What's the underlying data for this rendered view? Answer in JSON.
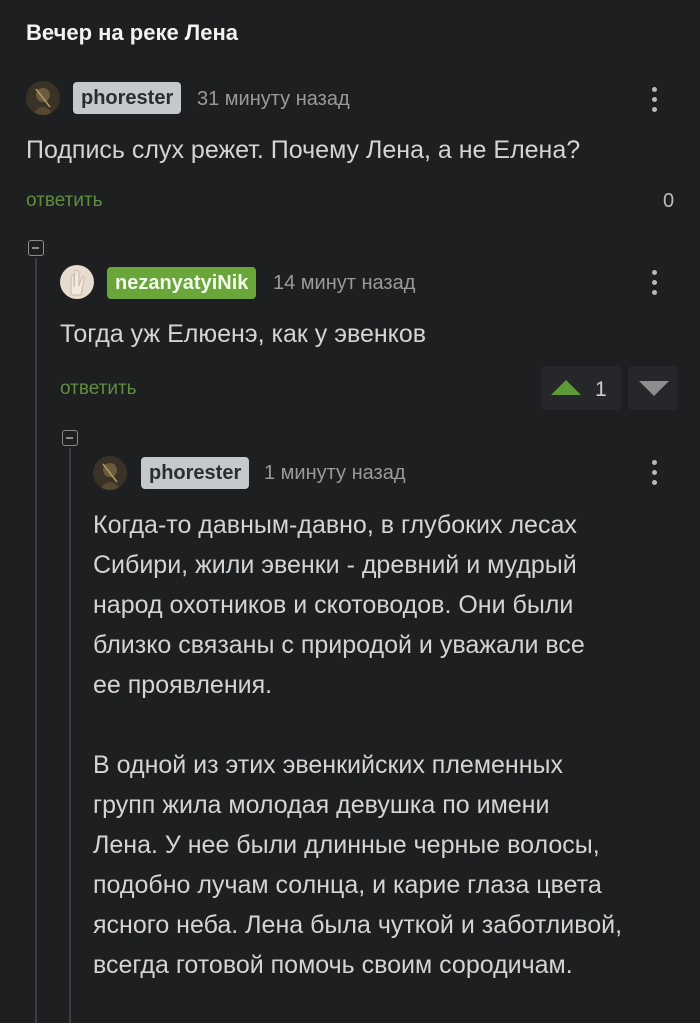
{
  "post": {
    "title": "Вечер на реке Лена"
  },
  "comments": [
    {
      "username": "phorester",
      "time": "31 минуту назад",
      "text": "Подпись слух режет. Почему Лена, а не Елена?",
      "reply_label": "ответить",
      "score": "0"
    },
    {
      "username": "nezanyatyiNik",
      "time": "14 минут назад",
      "text": "Тогда уж Елюенэ, как у эвенков",
      "reply_label": "ответить",
      "score": "1"
    },
    {
      "username": "phorester",
      "time": "1 минуту назад",
      "text": "Когда-то давным-давно, в глубоких лесах\nСибири, жили эвенки - древний и мудрый\nнарод охотников и скотоводов. Они были\nблизко связаны с природой и уважали все\nее проявления.\n\nВ одной из этих эвенкийских племенных\nгрупп жила молодая девушка по имени\nЛена. У нее были длинные черные волосы,\nподобно лучам солнца, и карие глаза цвета\nясного неба. Лена была чуткой и заботливой,\nвсегда готовой помочь своим сородичам."
    }
  ],
  "colors": {
    "background": "#1e1f21",
    "reply_link": "#5e8f3e",
    "badge_green": "#6aa63a",
    "badge_gray": "#c5c8cc",
    "vote_up": "#5e9a35"
  },
  "icons": [
    "avatar",
    "menu-dots-icon",
    "collapse-icon",
    "upvote-icon",
    "downvote-icon"
  ]
}
